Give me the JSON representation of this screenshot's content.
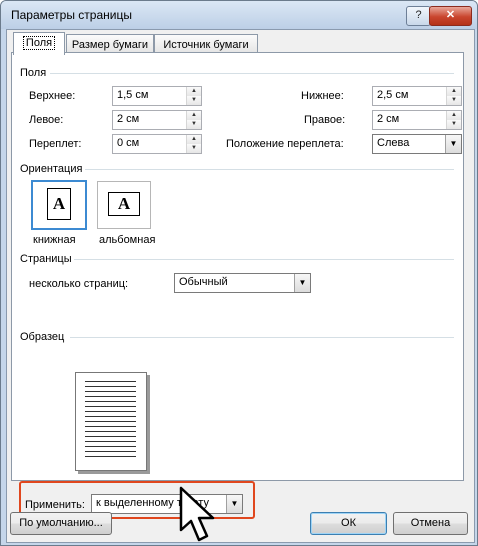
{
  "window": {
    "title": "Параметры страницы",
    "help_label": "?",
    "close_label": "✕"
  },
  "tabs": [
    {
      "label": "Поля",
      "active": true
    },
    {
      "label": "Размер бумаги",
      "active": false
    },
    {
      "label": "Источник бумаги",
      "active": false
    }
  ],
  "margins": {
    "group_label": "Поля",
    "top": {
      "label": "Верхнее:",
      "value": "1,5 см"
    },
    "bottom": {
      "label": "Нижнее:",
      "value": "2,5 см"
    },
    "left": {
      "label": "Левое:",
      "value": "2 см"
    },
    "right": {
      "label": "Правое:",
      "value": "2 см"
    },
    "gutter": {
      "label": "Переплет:",
      "value": "0 см"
    },
    "gutter_position": {
      "label": "Положение переплета:",
      "value": "Слева"
    }
  },
  "orientation": {
    "group_label": "Ориентация",
    "portrait_label": "книжная",
    "landscape_label": "альбомная",
    "icon_letter": "A",
    "selected": "portrait"
  },
  "pages": {
    "group_label": "Страницы",
    "multiple_label": "несколько страниц:",
    "multiple_value": "Обычный"
  },
  "preview": {
    "group_label": "Образец"
  },
  "apply": {
    "label": "Применить:",
    "value": "к выделенному тексту"
  },
  "buttons": {
    "default": "По умолчанию...",
    "ok": "ОК",
    "cancel": "Отмена"
  },
  "arrows": {
    "up": "▲",
    "down": "▼"
  }
}
